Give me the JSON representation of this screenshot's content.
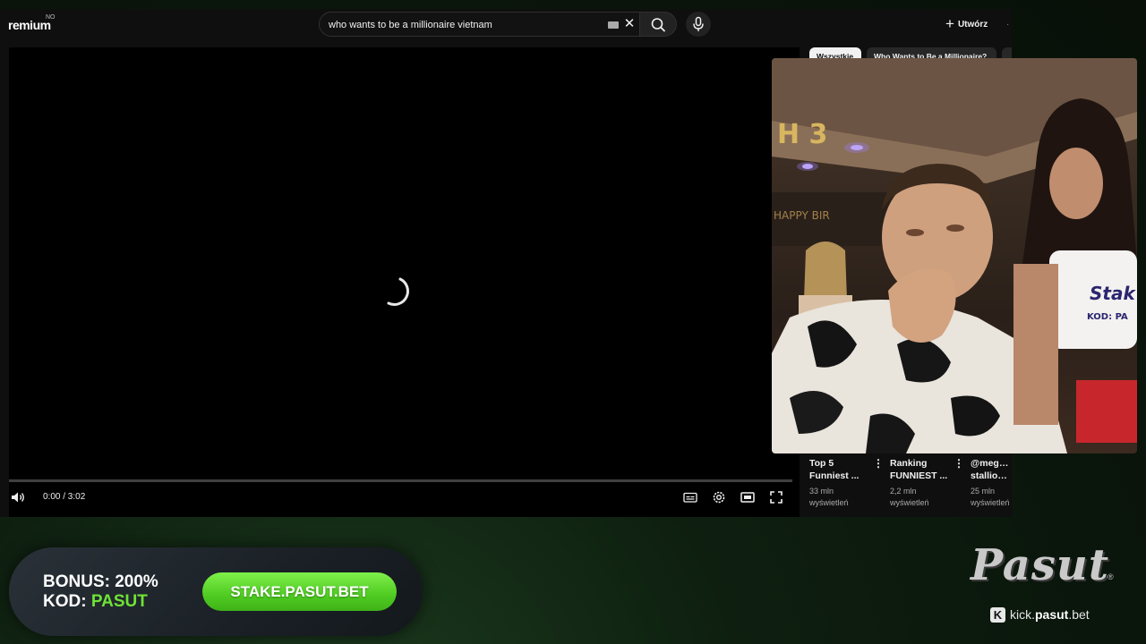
{
  "header": {
    "logo_text": "remium",
    "logo_badge": "NO",
    "search_value": "who wants to be a millionaire vietnam",
    "create_label": "Utwórz"
  },
  "player": {
    "time_display": "0:00 / 3:02",
    "progress_fraction": 0
  },
  "sidebar": {
    "chips": [
      {
        "label": "Wszystkie",
        "selected": true
      },
      {
        "label": "Who Wants to Be a Millionaire?",
        "selected": false
      }
    ],
    "recommendations": [
      {
        "title_line1": "Top 5",
        "title_line2": "Funniest ...",
        "views": "33 mln",
        "views_label": "wyświetleń"
      },
      {
        "title_line1": "Ranking",
        "title_line2": "FUNNIEST ...",
        "views": "2,2 mln",
        "views_label": "wyświetleń"
      },
      {
        "title_line1": "@megant",
        "title_line2": "stallion ...",
        "views": "25 mln",
        "views_label": "wyświetleń"
      }
    ]
  },
  "banner": {
    "bonus_label": "BONUS:",
    "bonus_value": "200%",
    "code_label": "KOD:",
    "code_value": "PASUT",
    "cta_label": "STAKE.PASUT.BET"
  },
  "brand": {
    "logo": "Pasut",
    "reg_mark": "®",
    "kick_prefix": "kick.",
    "kick_domain": "pasut",
    "kick_suffix": ".bet"
  },
  "colors": {
    "accent_green": "#6ee336",
    "cta_green": "#4fcb22",
    "yt_background": "#0f0f0f"
  },
  "icons": {
    "search": "search-icon",
    "mic": "mic-icon",
    "clear": "close-icon",
    "volume": "volume-icon",
    "subtitles": "subtitles-icon",
    "settings": "gear-icon",
    "theater": "theater-mode-icon",
    "fullscreen": "fullscreen-icon",
    "kick": "kick-icon"
  }
}
